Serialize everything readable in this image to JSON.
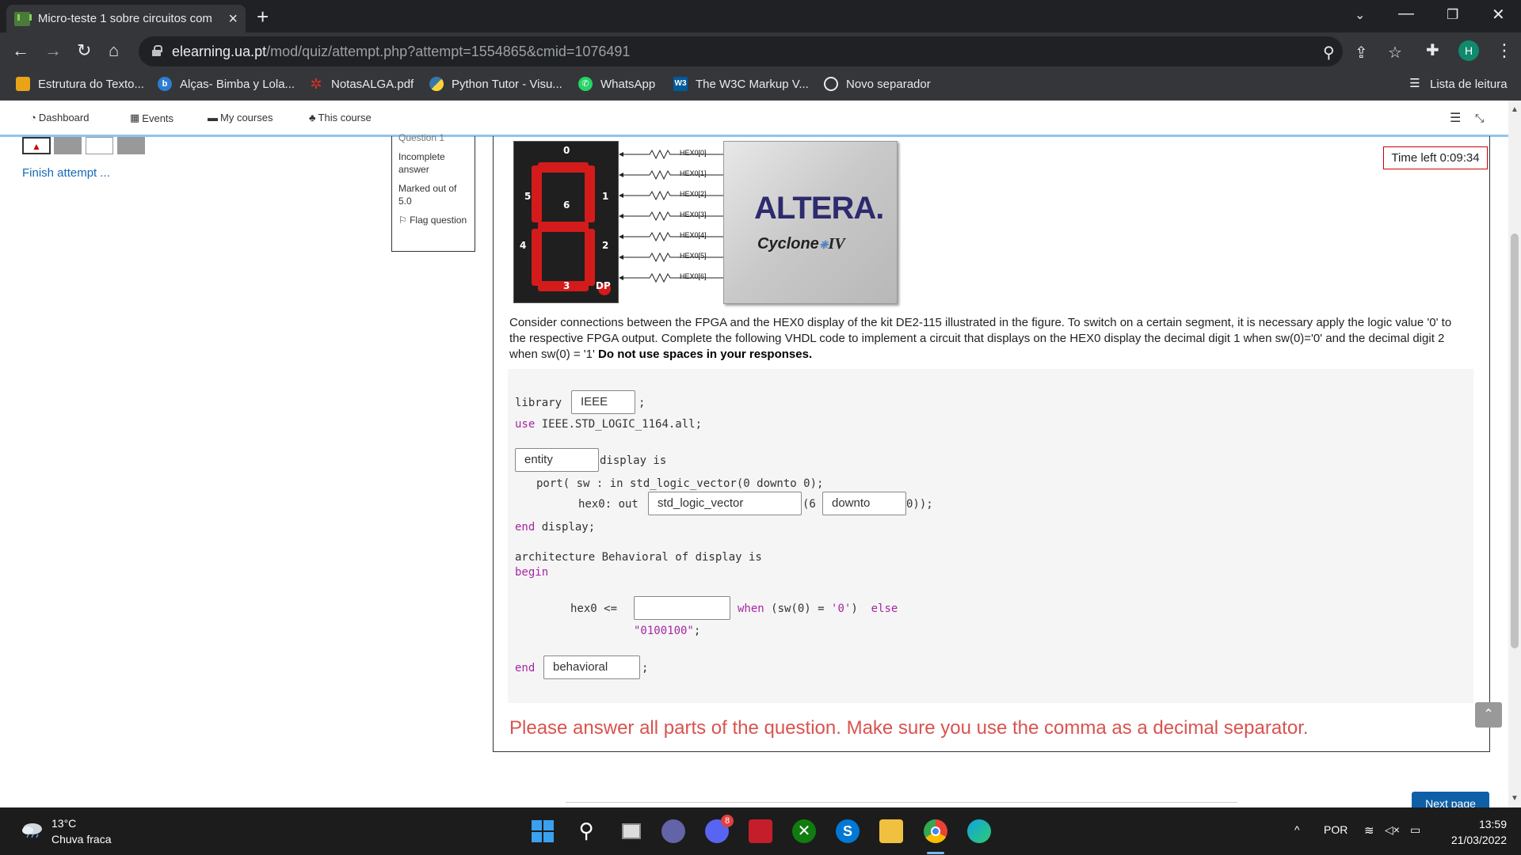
{
  "browser": {
    "tab_title": "Micro-teste 1 sobre circuitos com",
    "url_domain": "elearning.ua.pt",
    "url_path": "/mod/quiz/attempt.php?attempt=1554865&cmid=1076491",
    "profile_initial": "H"
  },
  "bookmarks": [
    {
      "label": "Estrutura do Texto...",
      "icon": "bookmark-favicon-icon",
      "color": "#e8a317"
    },
    {
      "label": "Alças- Bimba y Lola...",
      "icon": "bimba-favicon-icon",
      "color": "#2d7dd2"
    },
    {
      "label": "NotasALGA.pdf",
      "icon": "pdf-favicon-icon",
      "color": "#d93025"
    },
    {
      "label": "Python Tutor - Visu...",
      "icon": "python-favicon-icon",
      "color": "#3776ab"
    },
    {
      "label": "WhatsApp",
      "icon": "whatsapp-icon",
      "color": "#25d366"
    },
    {
      "label": "The W3C Markup V...",
      "icon": "w3c-favicon-icon",
      "color": "#005a9c"
    },
    {
      "label": "Novo separador",
      "icon": "chrome-newtab-icon",
      "color": "#e8eaed"
    }
  ],
  "reading_list": "Lista de leitura",
  "moodle_nav": {
    "dashboard": "Dashboard",
    "events": "Events",
    "my_courses": "My courses",
    "this_course": "This course"
  },
  "quiz_nav": {
    "finish_attempt": "Finish attempt ..."
  },
  "question_info": {
    "question_label": "Question 1",
    "state": "Incomplete answer",
    "marks": "Marked out of 5.0",
    "flag": "Flag question"
  },
  "timer": "Time left 0:09:34",
  "figure": {
    "hex_labels": [
      "HEX0[0]",
      "HEX0[1]",
      "HEX0[2]",
      "HEX0[3]",
      "HEX0[4]",
      "HEX0[5]",
      "HEX0[6]"
    ],
    "segment_labels": {
      "s0": "0",
      "s1": "1",
      "s2": "2",
      "s3": "3",
      "s4": "4",
      "s5": "5",
      "s6": "6",
      "dp": "DP"
    },
    "fpga_brand": "ALTERA.",
    "fpga_model": "Cyclone",
    "fpga_model_suffix": "IV"
  },
  "prompt": {
    "text": "Consider connections between the FPGA and the HEX0 display of the kit DE2-115 illustrated in the figure. To switch on a certain segment, it is necessary apply the logic value '0' to the respective FPGA output. Complete the following VHDL code to implement a circuit that displays on the HEX0 display the decimal digit 1 when sw(0)='0' and the decimal digit 2 when sw(0) = '1'",
    "bold": " Do not use spaces in your responses."
  },
  "code": {
    "library_kw": "library",
    "library_value": "IEEE",
    "semicolon": ";",
    "use_kw": "use",
    "use_rest": " IEEE.STD_LOGIC_1164.all;",
    "entity_value": "entity",
    "display_is": "display is",
    "port_line": "port( sw : in std_logic_vector(0 downto 0);",
    "hex0_out": "hex0: out",
    "type_value": "std_logic_vector",
    "paren6": "(6",
    "downto_value": "downto",
    "close": "0));",
    "end_kw": "end",
    "end_display": " display;",
    "architecture_line": "architecture Behavioral of display is",
    "begin_kw": "begin",
    "hex0_assign": "hex0 <=",
    "assign_value": "",
    "when_kw": "when",
    "when_cond": " (sw(0) = ",
    "zero_lit": "'0'",
    "else_kw": " else",
    "else_value": "\"0100100\"",
    "else_end": ";",
    "end_value": "behavioral"
  },
  "warning": "Please answer all parts of the question. Make sure you use the comma as a decimal separator.",
  "next_button": "Next page",
  "taskbar": {
    "temp": "13°C",
    "weather": "Chuva fraca",
    "lang": "POR",
    "time": "13:59",
    "date": "21/03/2022",
    "discord_badge": "8"
  }
}
